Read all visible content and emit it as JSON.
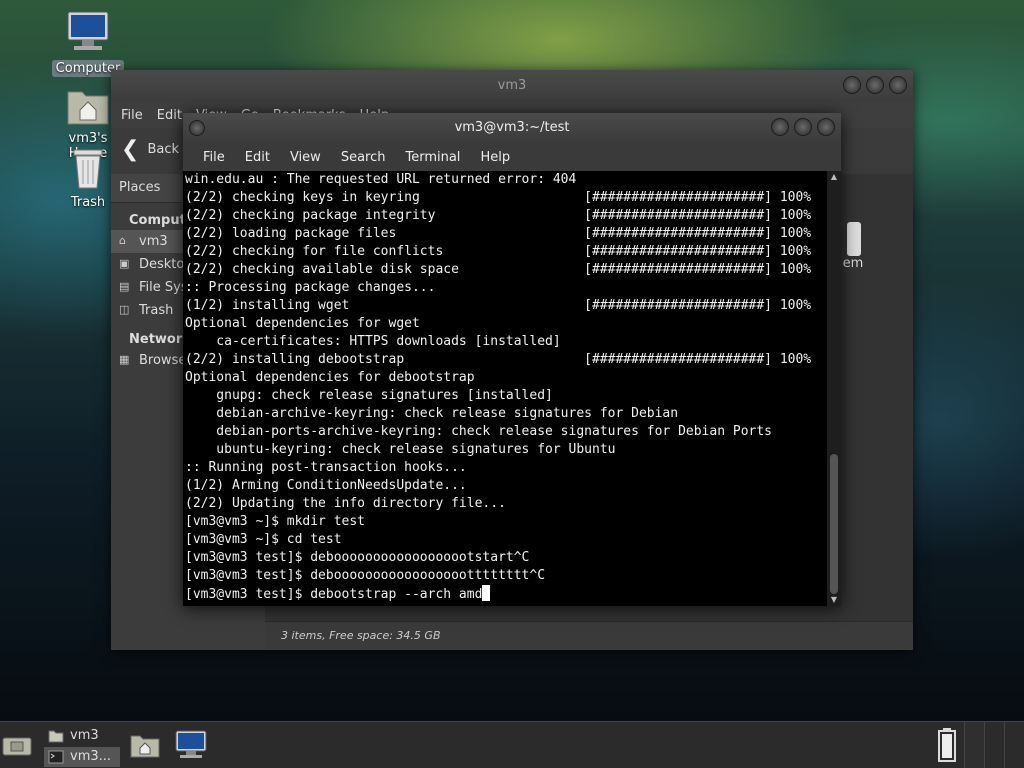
{
  "desktop": {
    "icons": [
      {
        "label": "Computer",
        "icon": "computer-icon"
      },
      {
        "label": "vm3's Home",
        "icon": "home-folder-icon"
      },
      {
        "label": "Trash",
        "icon": "trash-icon"
      }
    ]
  },
  "file_manager": {
    "title": "vm3",
    "menu": [
      "File",
      "Edit",
      "View",
      "Go",
      "Bookmarks",
      "Help"
    ],
    "back_label": "Back",
    "places_label": "Places",
    "computer_header": "Computer",
    "computer_items": [
      {
        "label": "vm3",
        "icon": "home-icon"
      },
      {
        "label": "Desktop",
        "icon": "desktop-icon"
      },
      {
        "label": "File System",
        "icon": "drive-icon"
      },
      {
        "label": "Trash",
        "icon": "trash-icon"
      }
    ],
    "network_header": "Network",
    "network_items": [
      {
        "label": "Browse Network",
        "icon": "network-icon"
      }
    ],
    "partial_icon_label": "em",
    "status": "3 items, Free space: 34.5 GB"
  },
  "terminal": {
    "title": "vm3@vm3:~/test",
    "menu": [
      "File",
      "Edit",
      "View",
      "Search",
      "Terminal",
      "Help"
    ],
    "lines": [
      "win.edu.au : The requested URL returned error: 404",
      "(2/2) checking keys in keyring                     [######################] 100%",
      "(2/2) checking package integrity                   [######################] 100%",
      "(2/2) loading package files                        [######################] 100%",
      "(2/2) checking for file conflicts                  [######################] 100%",
      "(2/2) checking available disk space                [######################] 100%",
      ":: Processing package changes...",
      "(1/2) installing wget                              [######################] 100%",
      "Optional dependencies for wget",
      "    ca-certificates: HTTPS downloads [installed]",
      "(2/2) installing debootstrap                       [######################] 100%",
      "Optional dependencies for debootstrap",
      "    gnupg: check release signatures [installed]",
      "    debian-archive-keyring: check release signatures for Debian",
      "    debian-ports-archive-keyring: check release signatures for Debian Ports",
      "    ubuntu-keyring: check release signatures for Ubuntu",
      ":: Running post-transaction hooks...",
      "(1/2) Arming ConditionNeedsUpdate...",
      "(2/2) Updating the info directory file...",
      "[vm3@vm3 ~]$ mkdir test",
      "[vm3@vm3 ~]$ cd test",
      "[vm3@vm3 test]$ deboooooooooooooooootstart^C",
      "[vm3@vm3 test]$ deboooooooooooooooootttttttt^C"
    ],
    "prompt_line": "[vm3@vm3 test]$ debootstrap --arch amd"
  },
  "taskbar": {
    "items": [
      {
        "label": "vm3",
        "icon": "folder-icon",
        "active": false
      },
      {
        "label": "vm3...",
        "icon": "terminal-icon",
        "active": true
      }
    ]
  }
}
